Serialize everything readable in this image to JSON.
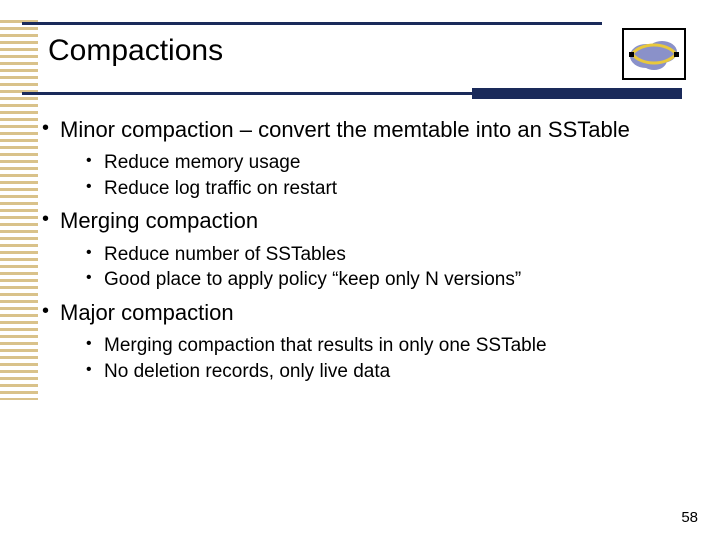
{
  "title": "Compactions",
  "logo": {
    "name": "bigtable-logo-icon"
  },
  "bullets": [
    {
      "text": "Minor compaction – convert the memtable into an SSTable",
      "sub": [
        "Reduce memory usage",
        "Reduce log traffic on restart"
      ]
    },
    {
      "text": "Merging compaction",
      "sub": [
        "Reduce number of SSTables",
        "Good place to apply policy “keep only N versions”"
      ]
    },
    {
      "text": "Major compaction",
      "sub": [
        "Merging compaction that results in only one SSTable",
        "No deletion records, only live data"
      ]
    }
  ],
  "page_number": "58"
}
